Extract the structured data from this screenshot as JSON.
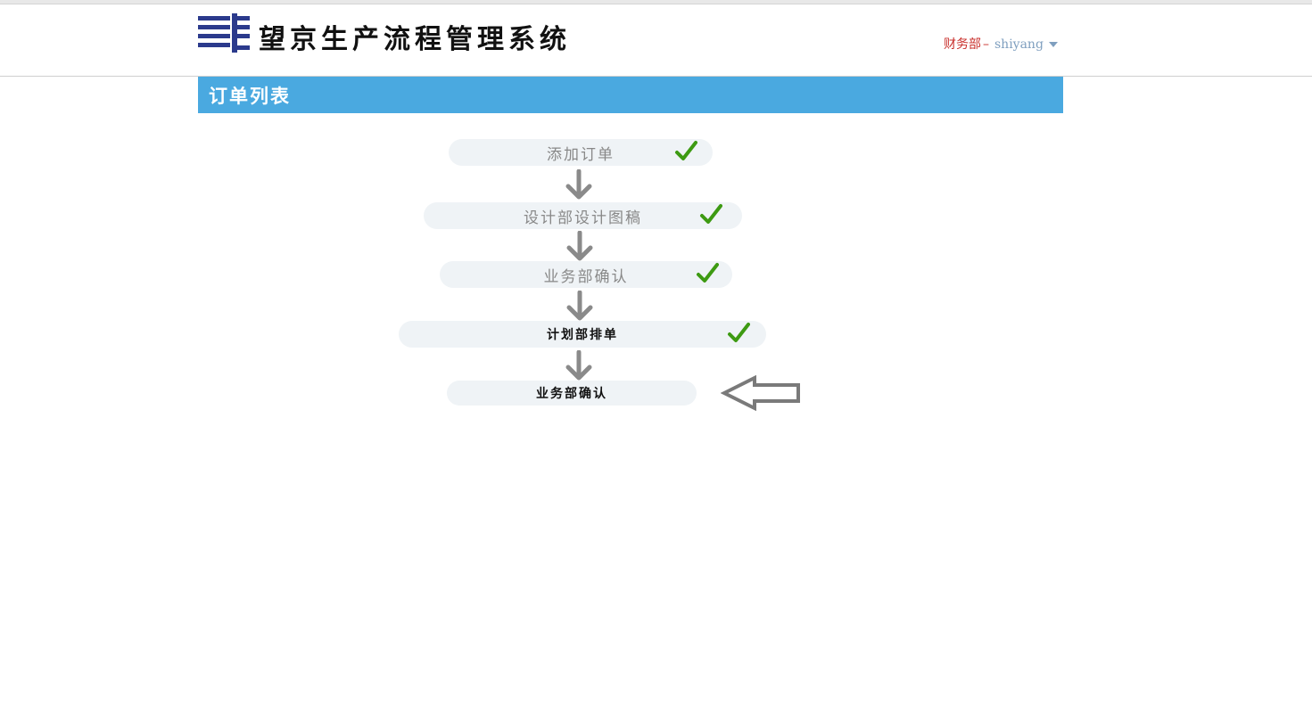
{
  "header": {
    "app_title": "望京生产流程管理系统",
    "logo_icon": "company-logo-icon",
    "department": "财务部",
    "separator": "–",
    "username": "shiyang"
  },
  "section": {
    "title": "订单列表"
  },
  "workflow": {
    "steps": [
      {
        "label": "添加订单",
        "status": "done"
      },
      {
        "label": "设计部设计图稿",
        "status": "done"
      },
      {
        "label": "业务部确认",
        "status": "done"
      },
      {
        "label": "计划部排单",
        "status": "done"
      },
      {
        "label": "业务部确认",
        "status": "current"
      }
    ],
    "check_icon": "check-icon",
    "arrow_icon": "arrow-down-icon",
    "pointer_icon": "arrow-left-outline-icon"
  },
  "colors": {
    "section_bar": "#4aa9e0",
    "department_text": "#c9302c",
    "username_text": "#7f9fbf",
    "check": "#3d9a12",
    "arrow": "#8a8a8a",
    "step_bg": "#eff3f6"
  }
}
